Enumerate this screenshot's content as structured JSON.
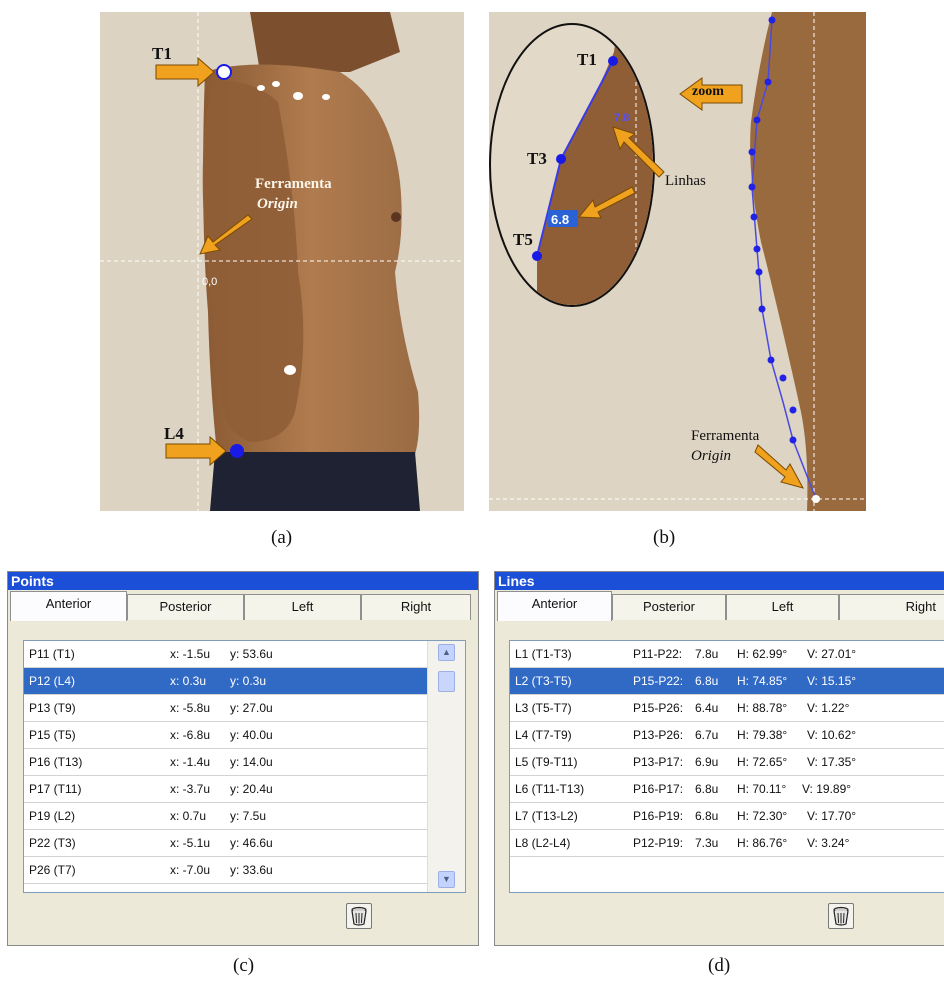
{
  "photo_a": {
    "labels": {
      "t1": "T1",
      "l4": "L4",
      "tool": "Ferramenta",
      "origin": "Origin",
      "coord": "0,0"
    },
    "caption": "(a)"
  },
  "photo_b": {
    "labels": {
      "t1": "T1",
      "t3": "T3",
      "t5": "T5",
      "line_value_1": "7.8",
      "line_value_2": "6.8",
      "zoom": "zoom",
      "lines": "Linhas",
      "tool": "Ferramenta",
      "origin": "Origin"
    },
    "caption": "(b)"
  },
  "points_panel": {
    "title": "Points",
    "tabs": [
      "Anterior",
      "Posterior",
      "Left",
      "Right"
    ],
    "active_tab": "Anterior",
    "rows": [
      {
        "name": "P11 (T1)",
        "x": "x: -1.5u",
        "y": "y: 53.6u"
      },
      {
        "name": "P12 (L4)",
        "x": "x: 0.3u",
        "y": "y: 0.3u"
      },
      {
        "name": "P13 (T9)",
        "x": "x: -5.8u",
        "y": "y: 27.0u"
      },
      {
        "name": "P15 (T5)",
        "x": "x: -6.8u",
        "y": "y: 40.0u"
      },
      {
        "name": "P16 (T13)",
        "x": "x: -1.4u",
        "y": "y: 14.0u"
      },
      {
        "name": "P17 (T11)",
        "x": "x: -3.7u",
        "y": "y: 20.4u"
      },
      {
        "name": "P19 (L2)",
        "x": "x: 0.7u",
        "y": "y: 7.5u"
      },
      {
        "name": "P22 (T3)",
        "x": "x: -5.1u",
        "y": "y: 46.6u"
      },
      {
        "name": "P26 (T7)",
        "x": "x: -7.0u",
        "y": "y: 33.6u"
      }
    ],
    "selected_row": "P12 (L4)",
    "caption": "(c)"
  },
  "lines_panel": {
    "title": "Lines",
    "tabs": [
      "Anterior",
      "Posterior",
      "Left",
      "Right"
    ],
    "active_tab": "Anterior",
    "rows": [
      {
        "name": "L1 (T1-T3)",
        "pts": "P11-P22:",
        "len": "7.8u",
        "h": "H: 62.99°",
        "v": "V: 27.01°"
      },
      {
        "name": "L2 (T3-T5)",
        "pts": "P15-P22:",
        "len": "6.8u",
        "h": "H: 74.85°",
        "v": "V: 15.15°"
      },
      {
        "name": "L3 (T5-T7)",
        "pts": "P15-P26:",
        "len": "6.4u",
        "h": "H: 88.78°",
        "v": "V: 1.22°"
      },
      {
        "name": "L4 (T7-T9)",
        "pts": "P13-P26:",
        "len": "6.7u",
        "h": "H: 79.38°",
        "v": "V: 10.62°"
      },
      {
        "name": "L5 (T9-T11)",
        "pts": "P13-P17:",
        "len": "6.9u",
        "h": "H: 72.65°",
        "v": "V: 17.35°"
      },
      {
        "name": "L6 (T11-T13)",
        "pts": "P16-P17:",
        "len": "6.8u",
        "h": "H: 70.11°",
        "v": "V: 19.89°"
      },
      {
        "name": "L7 (T13-L2)",
        "pts": "P16-P19:",
        "len": "6.8u",
        "h": "H: 72.30°",
        "v": "V: 17.70°"
      },
      {
        "name": "L8 (L2-L4)",
        "pts": "P12-P19:",
        "len": "7.3u",
        "h": "H: 86.76°",
        "v": "V: 3.24°"
      }
    ],
    "selected_row": "L2 (T3-T5)",
    "caption": "(d)"
  },
  "icons": {
    "delete": "trash-icon",
    "scroll_up": "chevron-up-icon",
    "scroll_down": "chevron-down-icon",
    "arrow": "arrow-icon",
    "marker": "marker-dot-icon"
  },
  "colors": {
    "title_bar": "#1b4fd8",
    "selection": "#316ac5",
    "arrow": "#f0a21e",
    "marker": "#1a1ae6",
    "tracing": "#4a4ae0"
  }
}
